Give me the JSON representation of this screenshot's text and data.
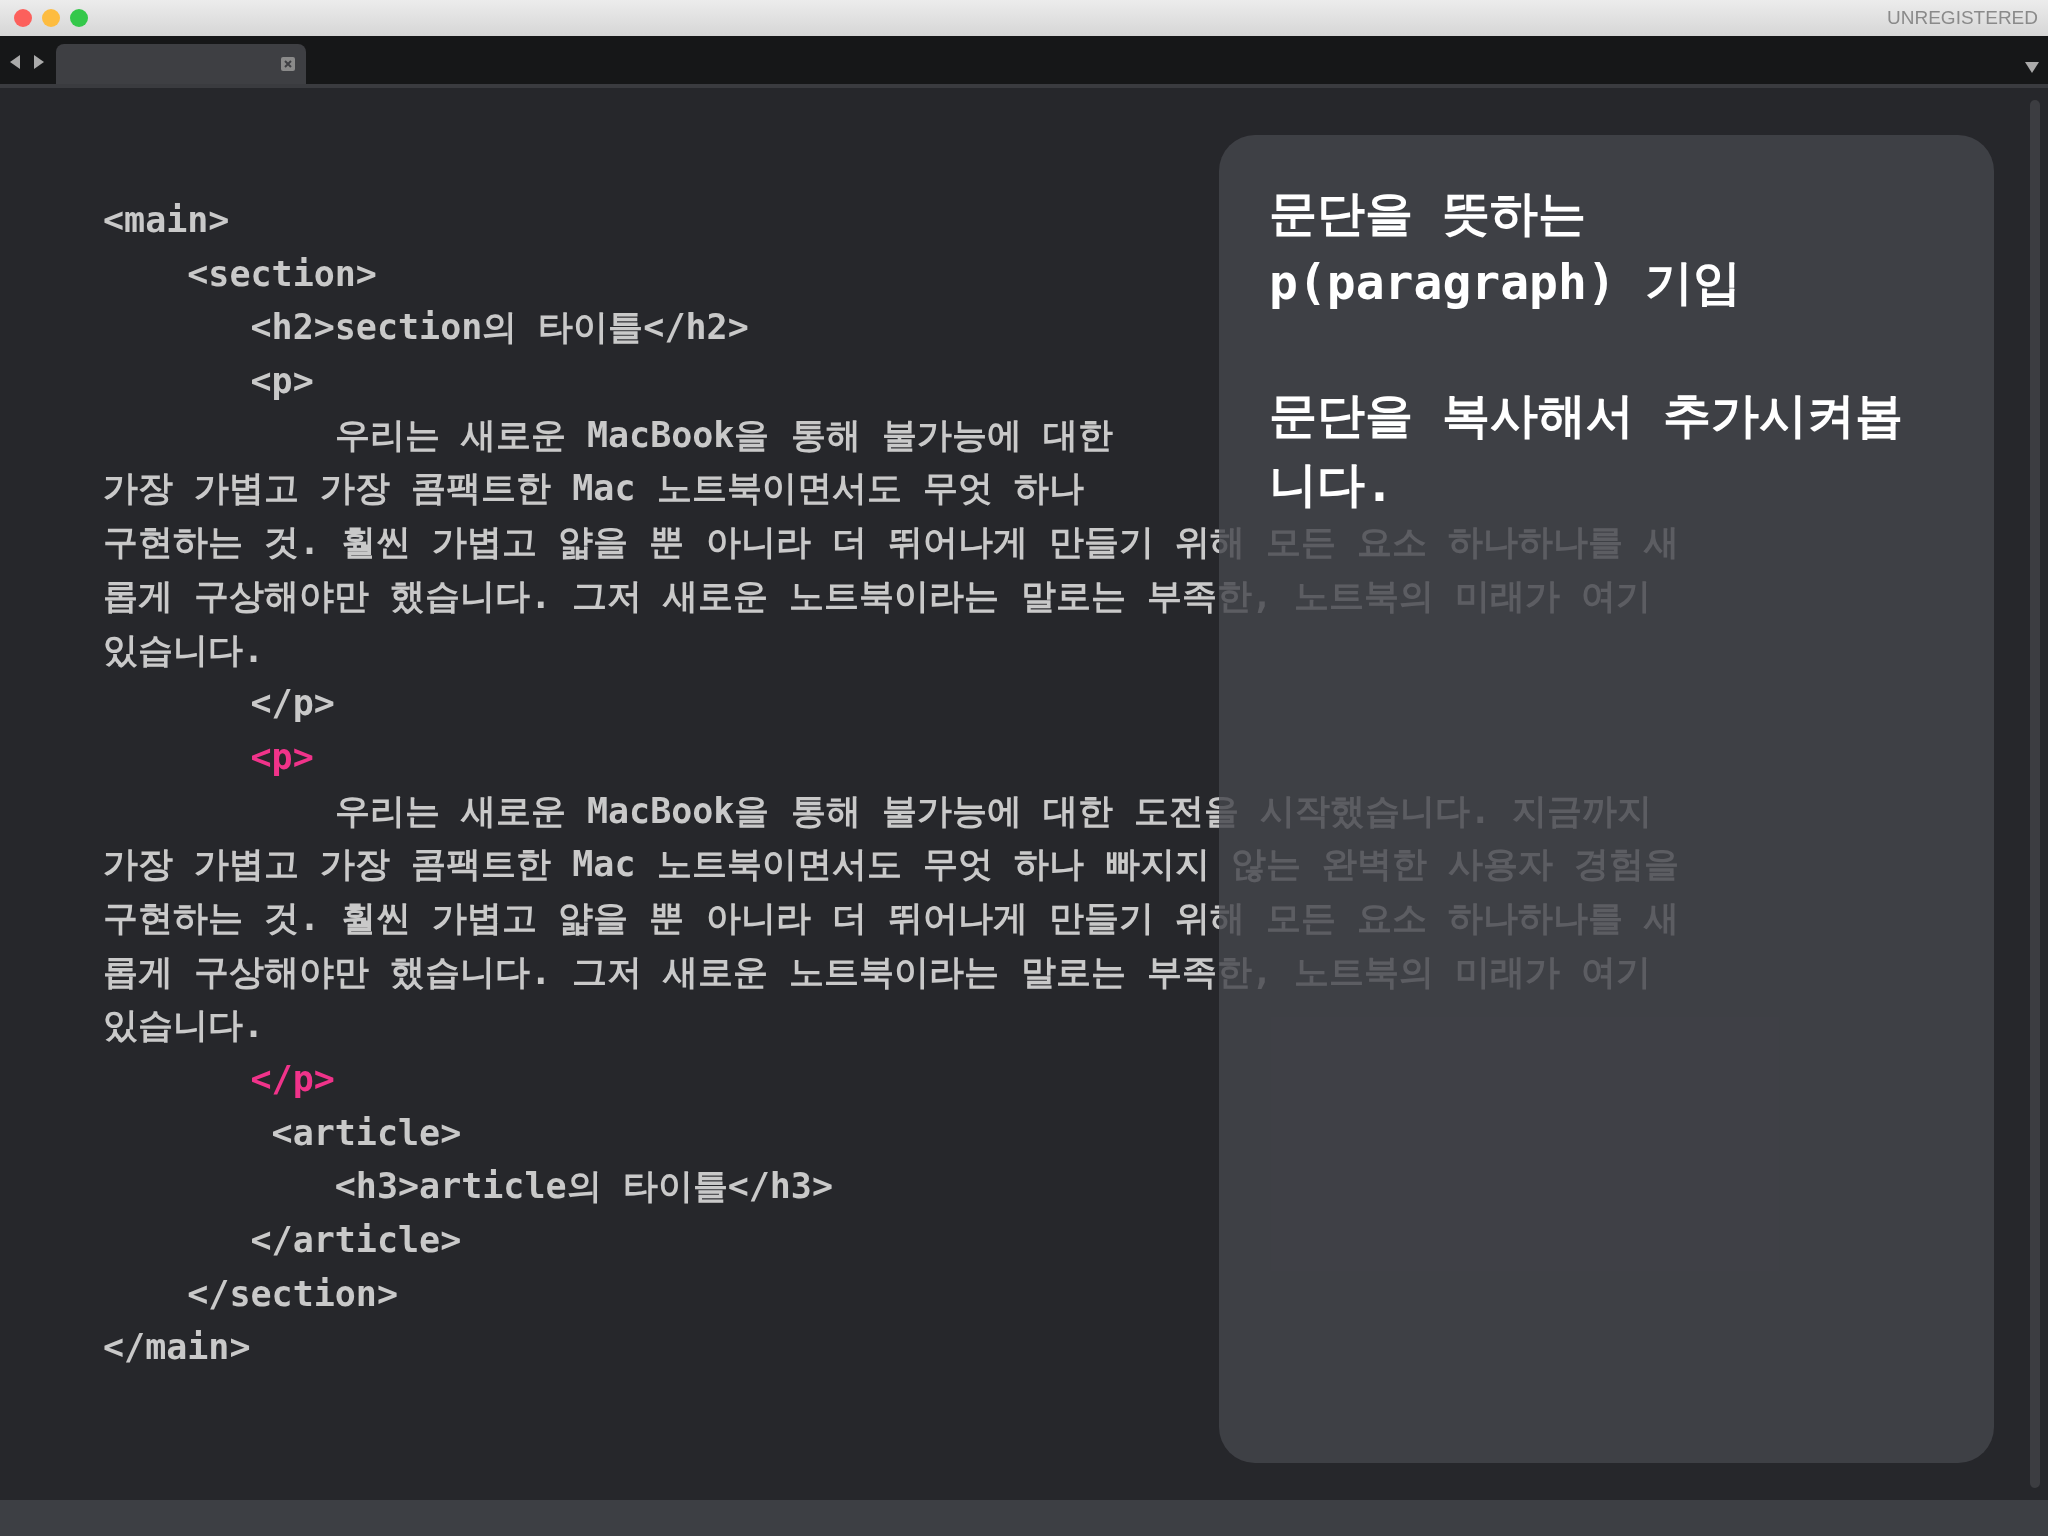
{
  "window": {
    "title": "UNREGISTERED"
  },
  "tabs": [
    {
      "selected": true
    }
  ],
  "code_lines": [
    {
      "text": "<main>",
      "highlight": false
    },
    {
      "text": "    <section>",
      "highlight": false
    },
    {
      "text": "       <h2>section의 타이틀</h2>",
      "highlight": false
    },
    {
      "text": "       <p>",
      "highlight": false
    },
    {
      "text": "           우리는 새로운 MacBook을 통해 불가능에 대한",
      "highlight": false
    },
    {
      "text": "가장 가볍고 가장 콤팩트한 Mac 노트북이면서도 무엇 하나",
      "highlight": false
    },
    {
      "text": "구현하는 것. 훨씬 가볍고 얇을 뿐 아니라 더 뛰어나게 만들기 위해 모든 요소 하나하나를 새",
      "highlight": false
    },
    {
      "text": "롭게 구상해야만 했습니다. 그저 새로운 노트북이라는 말로는 부족한, 노트북의 미래가 여기",
      "highlight": false
    },
    {
      "text": "있습니다.",
      "highlight": false
    },
    {
      "text": "       </p>",
      "highlight": false
    },
    {
      "text": "       <p>",
      "highlight": true
    },
    {
      "text": "           우리는 새로운 MacBook을 통해 불가능에 대한 도전을 시작했습니다. 지금까지",
      "highlight": false
    },
    {
      "text": "가장 가볍고 가장 콤팩트한 Mac 노트북이면서도 무엇 하나 빠지지 않는 완벽한 사용자 경험을",
      "highlight": false
    },
    {
      "text": "구현하는 것. 훨씬 가볍고 얇을 뿐 아니라 더 뛰어나게 만들기 위해 모든 요소 하나하나를 새",
      "highlight": false
    },
    {
      "text": "롭게 구상해야만 했습니다. 그저 새로운 노트북이라는 말로는 부족한, 노트북의 미래가 여기",
      "highlight": false
    },
    {
      "text": "있습니다.",
      "highlight": false
    },
    {
      "text": "       </p>",
      "highlight": true
    },
    {
      "text": "        <article>",
      "highlight": false
    },
    {
      "text": "           <h3>article의 타이틀</h3>",
      "highlight": false
    },
    {
      "text": "       </article>",
      "highlight": false
    },
    {
      "text": "    </section>",
      "highlight": false
    },
    {
      "text": "</main>",
      "highlight": false
    }
  ],
  "overlay": {
    "paragraphs": [
      "문단을 뜻하는 p(paragraph) 기입",
      "문단을 복사해서 추가시켜봅니다."
    ]
  }
}
